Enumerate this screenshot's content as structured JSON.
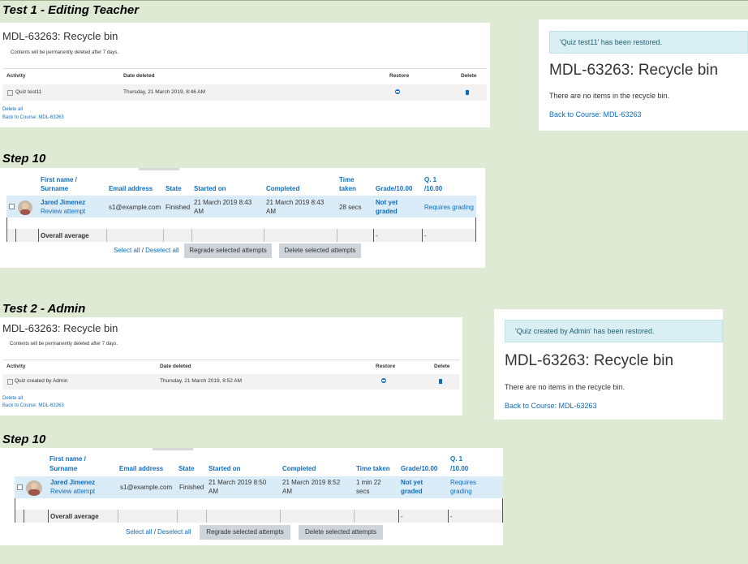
{
  "test1": {
    "heading": "Test 1 - Editing Teacher",
    "recycle": {
      "title": "MDL-63263: Recycle bin",
      "notice": "Contents will be permanently deleted after 7 days.",
      "columns": {
        "activity": "Activity",
        "date": "Date deleted",
        "restore": "Restore",
        "delete": "Delete"
      },
      "row": {
        "activity": "Quiz test11",
        "date": "Thursday, 21 March 2019, 8:46 AM"
      },
      "delete_all": "Delete all",
      "back": "Back to Course: MDL-63263"
    },
    "restored": {
      "alert": "'Quiz test11' has been restored.",
      "title": "MDL-63263: Recycle bin",
      "empty": "There are no items in the recycle bin.",
      "back": "Back to Course: MDL-63263"
    },
    "step_heading": "Step 10",
    "grades": {
      "headers": {
        "name1": "First name /",
        "name2": "Surname",
        "email": "Email address",
        "state": "State",
        "started": "Started on",
        "completed": "Completed",
        "time1": "Time",
        "time2": "taken",
        "grade": "Grade/10.00",
        "q1": "Q. 1",
        "q2": "/10.00"
      },
      "row": {
        "name": "Jared Jimenez",
        "review": "Review attempt",
        "email": "s1@example.com",
        "state": "Finished",
        "started1": "21 March 2019 8:43",
        "started2": "AM",
        "completed1": "21 March 2019 8:43",
        "completed2": "AM",
        "time1": "28 secs",
        "time2": "",
        "grade1": "Not yet",
        "grade2": "graded",
        "q1": "Requires grading",
        "q2": ""
      },
      "avg_label": "Overall average",
      "avg_grade": "-",
      "avg_q": "-",
      "select_all": "Select all",
      "sep": " / ",
      "deselect_all": "Deselect all",
      "regrade": "Regrade selected attempts",
      "delete": "Delete selected attempts"
    }
  },
  "test2": {
    "heading": "Test 2 - Admin",
    "recycle": {
      "title": "MDL-63263: Recycle bin",
      "notice": "Contents will be permanently deleted after 7 days.",
      "columns": {
        "activity": "Activity",
        "date": "Date deleted",
        "restore": "Restore",
        "delete": "Delete"
      },
      "row": {
        "activity": "Quiz created by Admin",
        "date": "Thursday, 21 March 2019, 8:52 AM"
      },
      "delete_all": "Delete all",
      "back": "Back to Course: MDL-63263"
    },
    "restored": {
      "alert": "'Quiz created by Admin' has been restored.",
      "title": "MDL-63263: Recycle bin",
      "empty": "There are no items in the recycle bin.",
      "back": "Back to Course: MDL-63263"
    },
    "step_heading": "Step 10",
    "grades": {
      "headers": {
        "name1": "First name /",
        "name2": "Surname",
        "email": "Email address",
        "state": "State",
        "started": "Started on",
        "completed": "Completed",
        "time1": "Time taken",
        "time2": "",
        "grade": "Grade/10.00",
        "q1": "Q. 1",
        "q2": "/10.00"
      },
      "row": {
        "name": "Jared Jimenez",
        "review": "Review attempt",
        "email": "s1@example.com",
        "state": "Finished",
        "started1": "21 March 2019 8:50",
        "started2": "AM",
        "completed1": "21 March 2019 8:52",
        "completed2": "AM",
        "time1": "1 min 22",
        "time2": "secs",
        "grade1": "Not yet",
        "grade2": "graded",
        "q1": "Requires",
        "q2": "grading"
      },
      "avg_label": "Overall average",
      "avg_grade": "-",
      "avg_q": "-",
      "select_all": "Select all",
      "sep": " / ",
      "deselect_all": "Deselect all",
      "regrade": "Regrade selected attempts",
      "delete": "Delete selected attempts"
    }
  },
  "colors": {
    "link": "#0f6cbf",
    "background": "#deead3",
    "alert": "#d9eff4",
    "selected_row": "#d9ecf7",
    "button": "#ced4da"
  },
  "icons": {
    "restore": "restore-circle-icon",
    "delete": "trash-icon",
    "quiz": "quiz-icon",
    "avatar": "user-avatar"
  }
}
